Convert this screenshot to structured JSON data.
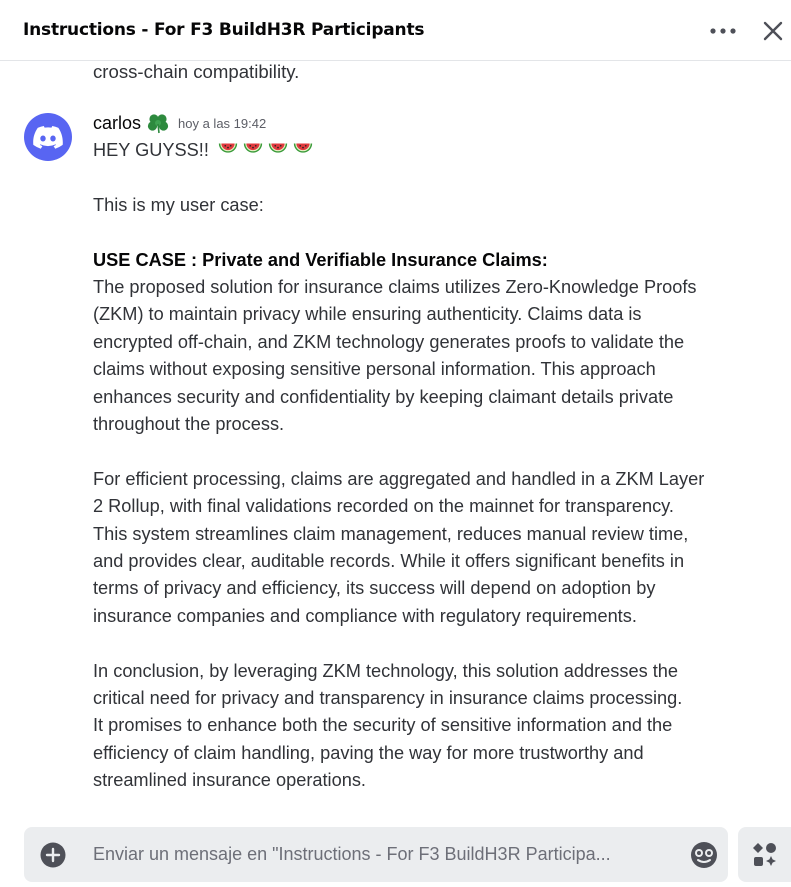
{
  "header": {
    "title": "Instructions - For F3 BuildH3R Participants",
    "more_icon": "more-horizontal-icon",
    "close_icon": "close-icon"
  },
  "previous_message": {
    "text": "cross-chain compatibility."
  },
  "message": {
    "avatar_icon": "discord-logo-icon",
    "username": "carlos",
    "role_icon": "clover-icon",
    "timestamp": "hoy a las 19:42",
    "greeting": "HEY GUYSS!!",
    "greeting_emoji": "watermelon-icon",
    "intro": "This is my user case:",
    "use_case_title": "USE CASE : Private and Verifiable Insurance Claims:",
    "paragraph1": [
      "The proposed solution for insurance claims utilizes Zero-Knowledge Proofs",
      "(ZKM) to maintain privacy while ensuring authenticity. Claims data is",
      "encrypted off-chain, and ZKM technology generates proofs to validate the",
      "claims without exposing sensitive personal information. This approach",
      "enhances security and confidentiality by keeping claimant details private",
      "throughout the process."
    ],
    "paragraph2": [
      "For efficient processing, claims are aggregated and handled in a ZKM Layer",
      "2 Rollup, with final validations recorded on the mainnet for transparency.",
      "This system streamlines claim management, reduces manual review time,",
      "and provides clear, auditable records. While it offers significant benefits in",
      "terms of privacy and efficiency, its success will depend on adoption by",
      "insurance companies and compliance with regulatory requirements."
    ],
    "paragraph3": [
      "In conclusion, by leveraging ZKM technology, this solution addresses the",
      "critical need for privacy and transparency in insurance claims processing.",
      "It promises to enhance both the security of sensitive information and the",
      "efficiency of claim handling, paving the way for more trustworthy and",
      "streamlined insurance operations."
    ]
  },
  "composer": {
    "add_icon": "plus-circle-icon",
    "placeholder": "Enviar un mensaje en \"Instructions - For F3 BuildH3R Participa...",
    "emoji_icon": "emoji-picker-icon",
    "apps_icon": "apps-icon"
  },
  "colors": {
    "accent": "#5865f2",
    "role_green": "#2d8a3e",
    "watermelon_red": "#e03a3e"
  }
}
